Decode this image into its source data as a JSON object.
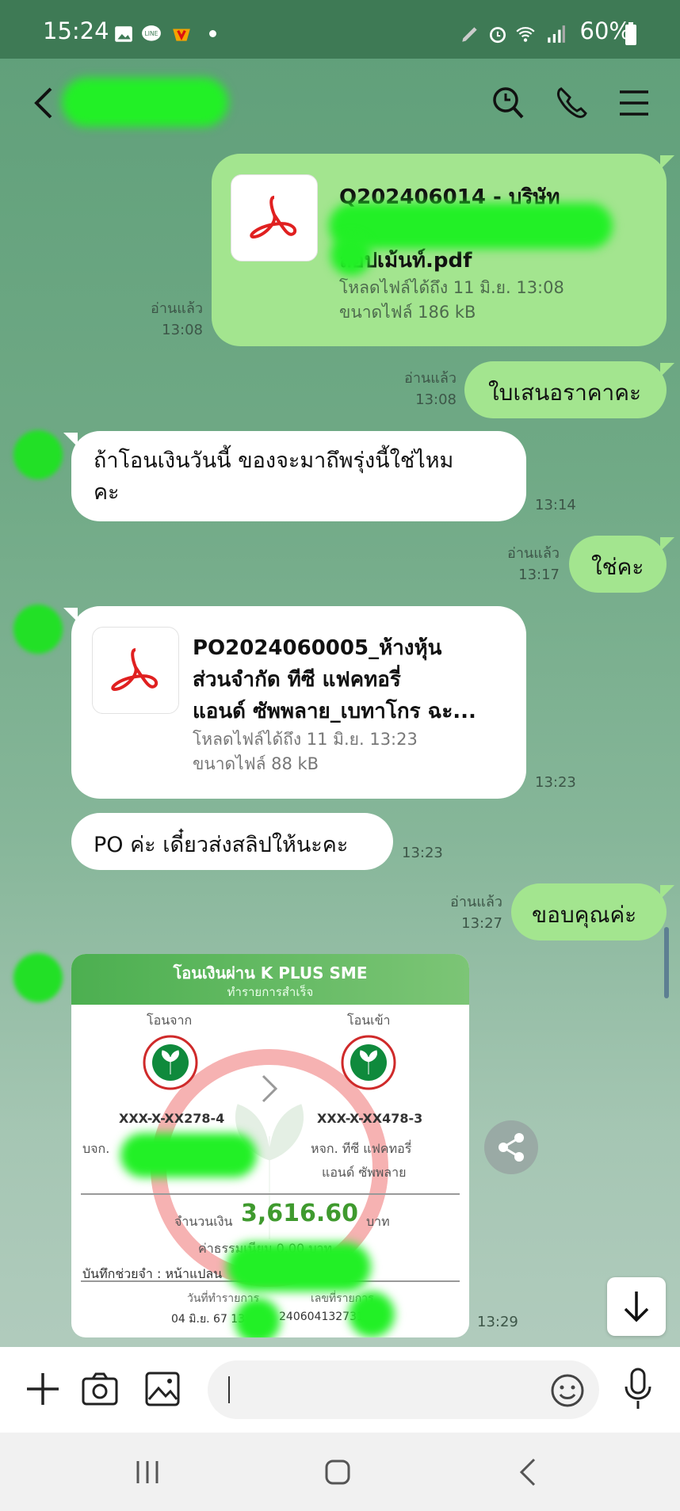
{
  "status": {
    "time": "15:24",
    "battery": "60%"
  },
  "header": {
    "back_icon": "chevron-left-icon",
    "search_icon": "search-icon",
    "call_icon": "phone-icon",
    "menu_icon": "menu-icon"
  },
  "messages": {
    "file1": {
      "name_line1": "Q202406014 - บริษัท",
      "name_line3": "ลอปเม้นท์.pdf",
      "expiry": "โหลดไฟล์ได้ถึง 11 มิ.ย. 13:08",
      "size": "ขนาดไฟล์ 186 kB",
      "read": "อ่านแล้ว",
      "time": "13:08"
    },
    "quote": {
      "text": "ใบเสนอราคาคะ",
      "read": "อ่านแล้ว",
      "time": "13:08"
    },
    "question": {
      "text": "ถ้าโอนเงินวันนี้ ของจะมาถึพรุ่งนี้ใช่ไหม\nคะ",
      "time": "13:14"
    },
    "yes": {
      "text": "ใช่คะ",
      "read": "อ่านแล้ว",
      "time": "13:17"
    },
    "file2": {
      "name_line1": "PO2024060005_ห้างหุ้น",
      "name_line2": "ส่วนจำกัด ทีซี แฟคทอรี่",
      "name_line3": "แอนด์ ซัพพลาย_เบทาโกร ฉะ...",
      "expiry": "โหลดไฟล์ได้ถึง 11 มิ.ย. 13:23",
      "size": "ขนาดไฟล์ 88 kB",
      "time": "13:23"
    },
    "po": {
      "text": "PO ค่ะ เดี๋ยวส่งสลิปให้นะคะ",
      "time": "13:23"
    },
    "thanks": {
      "text": "ขอบคุณค่ะ",
      "read": "อ่านแล้ว",
      "time": "13:27"
    },
    "slip": {
      "title": "โอนเงินผ่าน K PLUS SME",
      "subtitle": "ทำรายการสำเร็จ",
      "from_label": "โอนจาก",
      "to_label": "โอนเข้า",
      "from_acct": "XXX-X-XX278-4",
      "to_acct": "XXX-X-XX478-3",
      "from_name": "บจก.",
      "to_name1": "หจก. ทีซี แฟคทอรี่",
      "to_name2": "แอนด์ ซัพพลาย",
      "amount_label": "จำนวนเงิน",
      "amount": "3,616.60",
      "amount_unit": "บาท",
      "fee": "ค่าธรรมเนียม 0.00 บาท",
      "memo": "บันทึกช่วยจำ : หน้าแปลน",
      "date_label": "วันที่ทำรายการ",
      "ref_label": "เลขที่รายการ",
      "date": "04 มิ.ย. 67 13",
      "ref": "240604132731",
      "time": "13:29"
    }
  },
  "colors": {
    "mine": "#a3e58f",
    "status": "#3e7a55",
    "slip_header": "#5cb85c",
    "amount": "#3f9a2e"
  }
}
